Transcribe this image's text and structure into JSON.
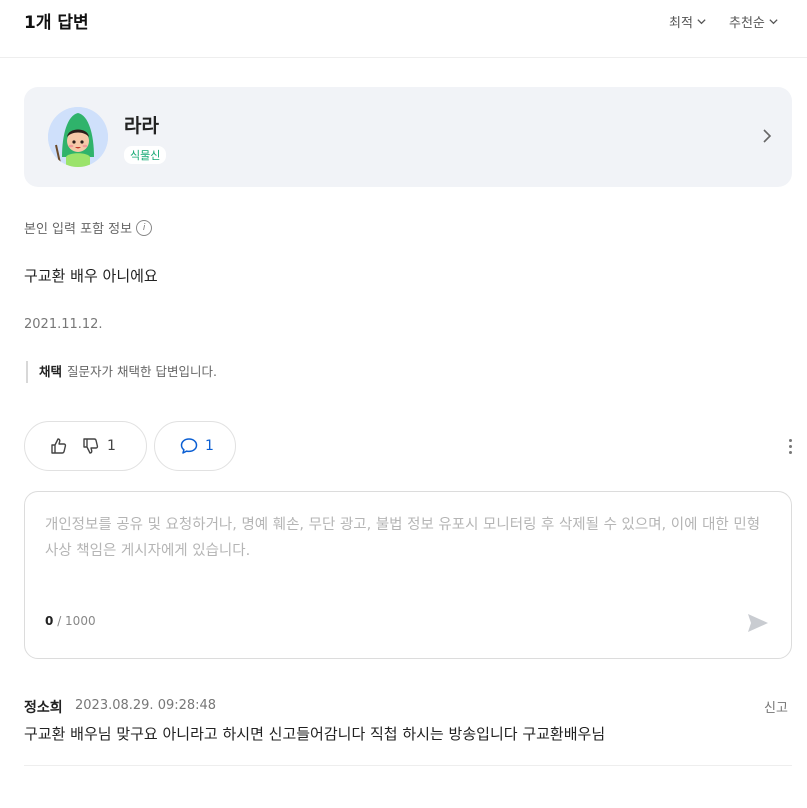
{
  "header": {
    "title": "1개 답변",
    "sort_latest": "최적",
    "sort_recommended": "추천순"
  },
  "author": {
    "name": "라라",
    "badge": "식물신"
  },
  "answer": {
    "info_label": "본인 입력 포함 정보",
    "info_icon_glyph": "i",
    "text": "구교환 배우 아니에요",
    "date": "2021.11.12.",
    "adopted_label": "채택",
    "adopted_text": "질문자가 채택한 답변입니다."
  },
  "actions": {
    "dislike_count": "1",
    "comment_count": "1",
    "comment_icon_color": "#0b5fd3"
  },
  "comment_form": {
    "placeholder": "개인정보를 공유 및 요청하거나, 명예 훼손, 무단 광고, 불법 정보 유포시 모니터링 후 삭제될 수 있으며, 이에 대한 민형사상 책임은 게시자에게 있습니다.",
    "value": "",
    "char_count": "0",
    "char_limit": "/ 1000"
  },
  "comments": [
    {
      "author": "정소희",
      "time": "2023.08.29. 09:28:48",
      "report_label": "신고",
      "text": "구교환 배우님 맞구요 아니라고 하시면 신고들어감니다 직첩 하시는 방송입니다 구교환배우님"
    }
  ]
}
